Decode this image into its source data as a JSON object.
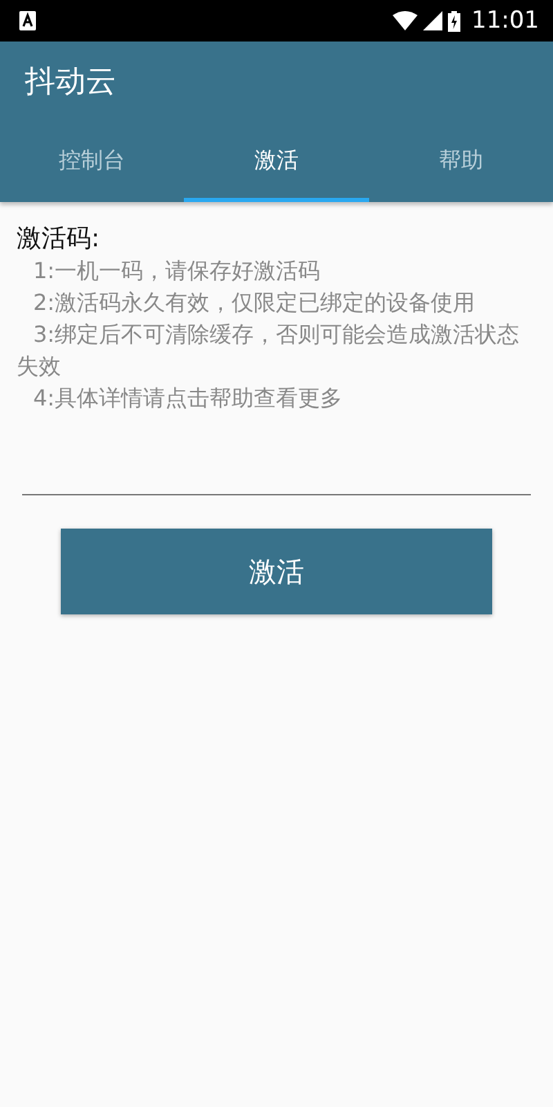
{
  "status_bar": {
    "time": "11:01"
  },
  "app_bar": {
    "title": "抖动云"
  },
  "tabs": [
    {
      "label": "控制台",
      "selected": false
    },
    {
      "label": "激活",
      "selected": true
    },
    {
      "label": "帮助",
      "selected": false
    }
  ],
  "section_title": "激活码:",
  "notes": [
    "1:一机一码，请保存好激活码",
    "2:激活码永久有效，仅限定已绑定的设备使用",
    "3:绑定后不可清除缓存，否则可能会造成激活状态失效",
    "4:具体详情请点击帮助查看更多"
  ],
  "activate_button": "激活"
}
